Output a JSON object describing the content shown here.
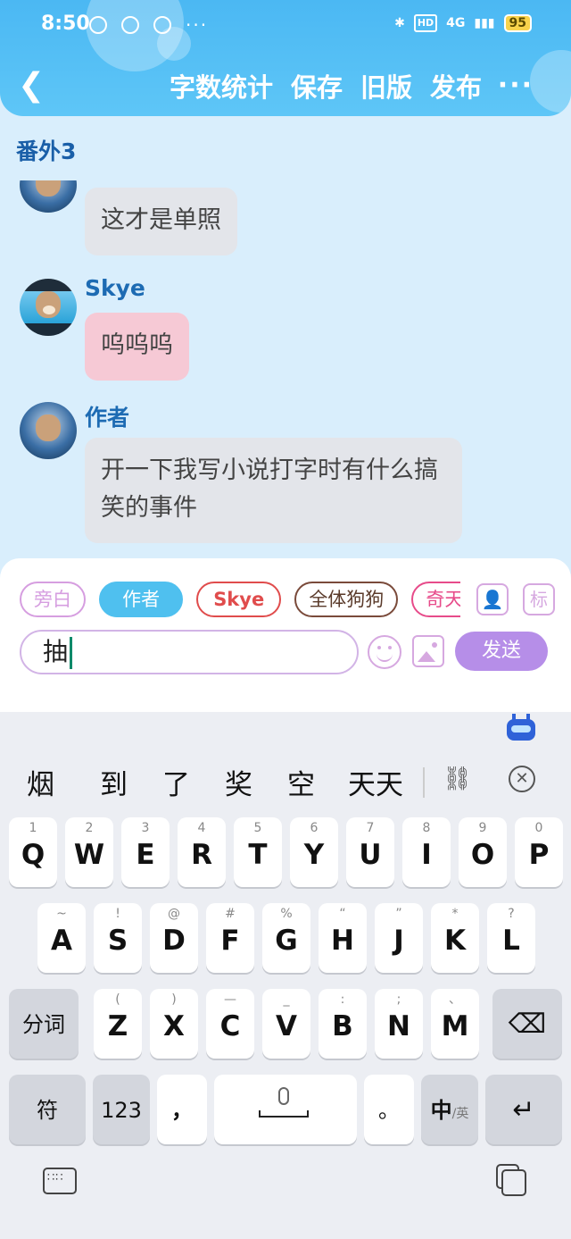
{
  "status_bar": {
    "time": "8:50",
    "left_dots": "···",
    "hd": "HD",
    "network": "4G",
    "battery": "95"
  },
  "nav": {
    "back_icon": "chevron-left",
    "actions": [
      "字数统计",
      "保存",
      "旧版",
      "发布"
    ],
    "more": "···"
  },
  "chapter_title": "番外3",
  "messages": [
    {
      "sender": "",
      "text": "这才是单照",
      "style": "gray"
    },
    {
      "sender": "Skye",
      "text": "呜呜呜",
      "style": "pink"
    },
    {
      "sender": "作者",
      "text": "开一下我写小说打字时有什么搞笑的事件",
      "style": "gray"
    }
  ],
  "composer": {
    "roles": [
      "旁白",
      "作者",
      "Skye",
      "全体狗狗",
      "奇天"
    ],
    "selected_role": "作者",
    "character_icon": "👤",
    "tag_icon_label": "标",
    "input_value": "抽",
    "send_label": "发送",
    "accent_color": "#b68ee8"
  },
  "keyboard": {
    "candidates": [
      "烟",
      "到",
      "了",
      "奖",
      "空",
      "天天"
    ],
    "row1": [
      {
        "key": "Q",
        "sub": "1"
      },
      {
        "key": "W",
        "sub": "2"
      },
      {
        "key": "E",
        "sub": "3"
      },
      {
        "key": "R",
        "sub": "4"
      },
      {
        "key": "T",
        "sub": "5"
      },
      {
        "key": "Y",
        "sub": "6"
      },
      {
        "key": "U",
        "sub": "7"
      },
      {
        "key": "I",
        "sub": "8"
      },
      {
        "key": "O",
        "sub": "9"
      },
      {
        "key": "P",
        "sub": "0"
      }
    ],
    "row2": [
      {
        "key": "A",
        "sub": "~"
      },
      {
        "key": "S",
        "sub": "!"
      },
      {
        "key": "D",
        "sub": "@"
      },
      {
        "key": "F",
        "sub": "#"
      },
      {
        "key": "G",
        "sub": "%"
      },
      {
        "key": "H",
        "sub": "“"
      },
      {
        "key": "J",
        "sub": "”"
      },
      {
        "key": "K",
        "sub": "*"
      },
      {
        "key": "L",
        "sub": "?"
      }
    ],
    "row3": [
      {
        "key": "Z",
        "sub": "("
      },
      {
        "key": "X",
        "sub": ")"
      },
      {
        "key": "C",
        "sub": "—"
      },
      {
        "key": "V",
        "sub": "_"
      },
      {
        "key": "B",
        "sub": ":"
      },
      {
        "key": "N",
        "sub": ";"
      },
      {
        "key": "M",
        "sub": "、"
      }
    ],
    "segment_label": "分词",
    "backspace_icon": "⌫",
    "symbol_label": "符",
    "numbers_label": "123",
    "comma": "，",
    "period": "。",
    "lang_label": "中",
    "lang_sub": "/英",
    "enter_icon": "↵"
  }
}
